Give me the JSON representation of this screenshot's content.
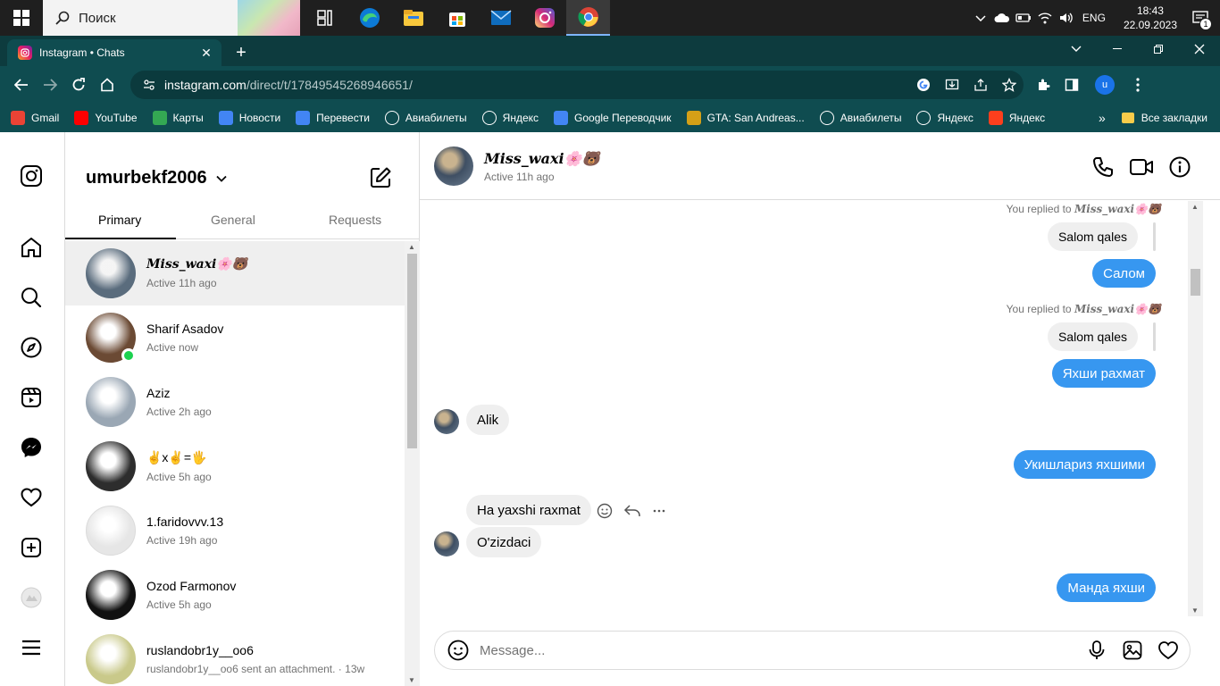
{
  "taskbar": {
    "search_placeholder": "Поиск",
    "lang": "ENG",
    "time": "18:43",
    "date": "22.09.2023",
    "notif_count": "1"
  },
  "browser": {
    "tab_title": "Instagram • Chats",
    "url_host": "instagram.com",
    "url_path": "/direct/t/17849545268946651/",
    "profile_letter": "u",
    "bookmarks": [
      {
        "label": "Gmail",
        "color": "#ea4335",
        "icon": "gmail-icon"
      },
      {
        "label": "YouTube",
        "color": "#ff0000",
        "icon": "youtube-icon"
      },
      {
        "label": "Карты",
        "color": "#34a853",
        "icon": "maps-icon"
      },
      {
        "label": "Новости",
        "color": "#4285f4",
        "icon": "news-icon"
      },
      {
        "label": "Перевести",
        "color": "#4285f4",
        "icon": "translate-icon"
      },
      {
        "label": "Авиабилеты",
        "color": "#ffffff",
        "icon": "globe-icon"
      },
      {
        "label": "Яндекс",
        "color": "#ffffff",
        "icon": "star-icon"
      },
      {
        "label": "Google Переводчик",
        "color": "#4285f4",
        "icon": "translate-icon"
      },
      {
        "label": "GTA: San Andreas...",
        "color": "#d4a017",
        "icon": "gta-icon"
      },
      {
        "label": "Авиабилеты",
        "color": "#ffffff",
        "icon": "globe-icon"
      },
      {
        "label": "Яндекс",
        "color": "#ffffff",
        "icon": "star-icon"
      },
      {
        "label": "Яндекс",
        "color": "#fc3f1d",
        "icon": "yandex-icon"
      }
    ],
    "all_bookmarks": "Все закладки"
  },
  "inbox": {
    "username": "umurbekf2006",
    "tabs": [
      "Primary",
      "General",
      "Requests"
    ],
    "threads": [
      {
        "name": "𝑴𝒊𝒔𝒔_𝒘𝒂𝒙𝒊🌸🐻",
        "sub": "Active 11h ago",
        "selected": true,
        "online": false,
        "avatar": "#5a6c7d"
      },
      {
        "name": "Sharif Asadov",
        "sub": "Active now",
        "selected": false,
        "online": true,
        "avatar": "#6b4a34"
      },
      {
        "name": "Aziz",
        "sub": "Active 2h ago",
        "selected": false,
        "online": false,
        "avatar": "#9aa7b4"
      },
      {
        "name": "✌️x✌️=🖐️",
        "sub": "Active 5h ago",
        "selected": false,
        "online": false,
        "avatar": "#2d2d2d"
      },
      {
        "name": "1.faridovvv.13",
        "sub": "Active 19h ago",
        "selected": false,
        "online": false,
        "avatar": "#e6e6e6"
      },
      {
        "name": "Ozod Farmonov",
        "sub": "Active 5h ago",
        "selected": false,
        "online": false,
        "avatar": "#111111"
      },
      {
        "name": "ruslandobr1y__oo6",
        "sub": "ruslandobr1y__oo6 sent an attachment. · 13w",
        "selected": false,
        "online": false,
        "avatar": "#c9c98a"
      }
    ]
  },
  "chat": {
    "name": "𝑴𝒊𝒔𝒔_𝒘𝒂𝒙𝒊🌸🐻",
    "status": "Active 11h ago",
    "replied_prefix": "You replied to ",
    "replied_name": "𝑴𝒊𝒔𝒔_𝒘𝒂𝒙𝒊🌸🐻",
    "messages": {
      "q1": "Salom qales",
      "m1": "Салом",
      "q2": "Salom qales",
      "m2": "Яхши рахмат",
      "t1": "Alik",
      "m3": "Укишлариз яхшими",
      "t2": "Ha yaxshi raxmat",
      "t3": "O'zizdaci",
      "m4": "Манда яхши"
    },
    "composer_placeholder": "Message..."
  }
}
